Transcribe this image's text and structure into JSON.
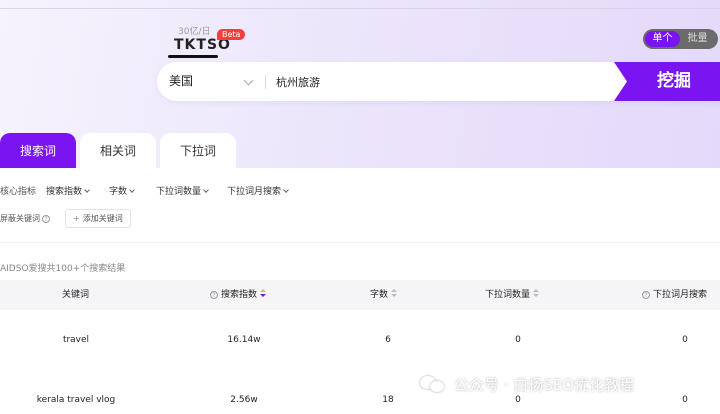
{
  "brand": {
    "subtitle": "30亿/日",
    "name": "TKTSO",
    "badge": "Beta"
  },
  "mode_toggle": {
    "single": "单个",
    "batch": "批量",
    "active": "single"
  },
  "search": {
    "country": "美国",
    "keyword": "杭州旅游",
    "submit_label": "挖掘"
  },
  "tabs": [
    {
      "label": "搜索词",
      "active": true
    },
    {
      "label": "相关词",
      "active": false
    },
    {
      "label": "下拉词",
      "active": false
    }
  ],
  "filters": {
    "label": "核心指标",
    "items": [
      "搜索指数",
      "字数",
      "下拉词数量",
      "下拉词月搜索"
    ]
  },
  "exclude": {
    "label": "屏蔽关键词",
    "add_label": "添加关键词"
  },
  "result_count": "AIDSO爱搜共100+个搜索结果",
  "table": {
    "headers": [
      "关键词",
      "搜索指数",
      "字数",
      "下拉词数量",
      "下拉词月搜索"
    ],
    "rows": [
      [
        "travel",
        "16.14w",
        "6",
        "0",
        "0"
      ],
      [
        "kerala travel vlog",
        "2.56w",
        "18",
        "0",
        "0"
      ]
    ]
  },
  "watermark": "公众号 · 白杨SEO优化教程",
  "colors": {
    "accent": "#7a14f0",
    "beta_badge": "#f43f3f"
  },
  "icons": [
    "chevron-down-icon",
    "help-circle-icon",
    "plus-icon",
    "sort-icon",
    "wechat-icon"
  ]
}
